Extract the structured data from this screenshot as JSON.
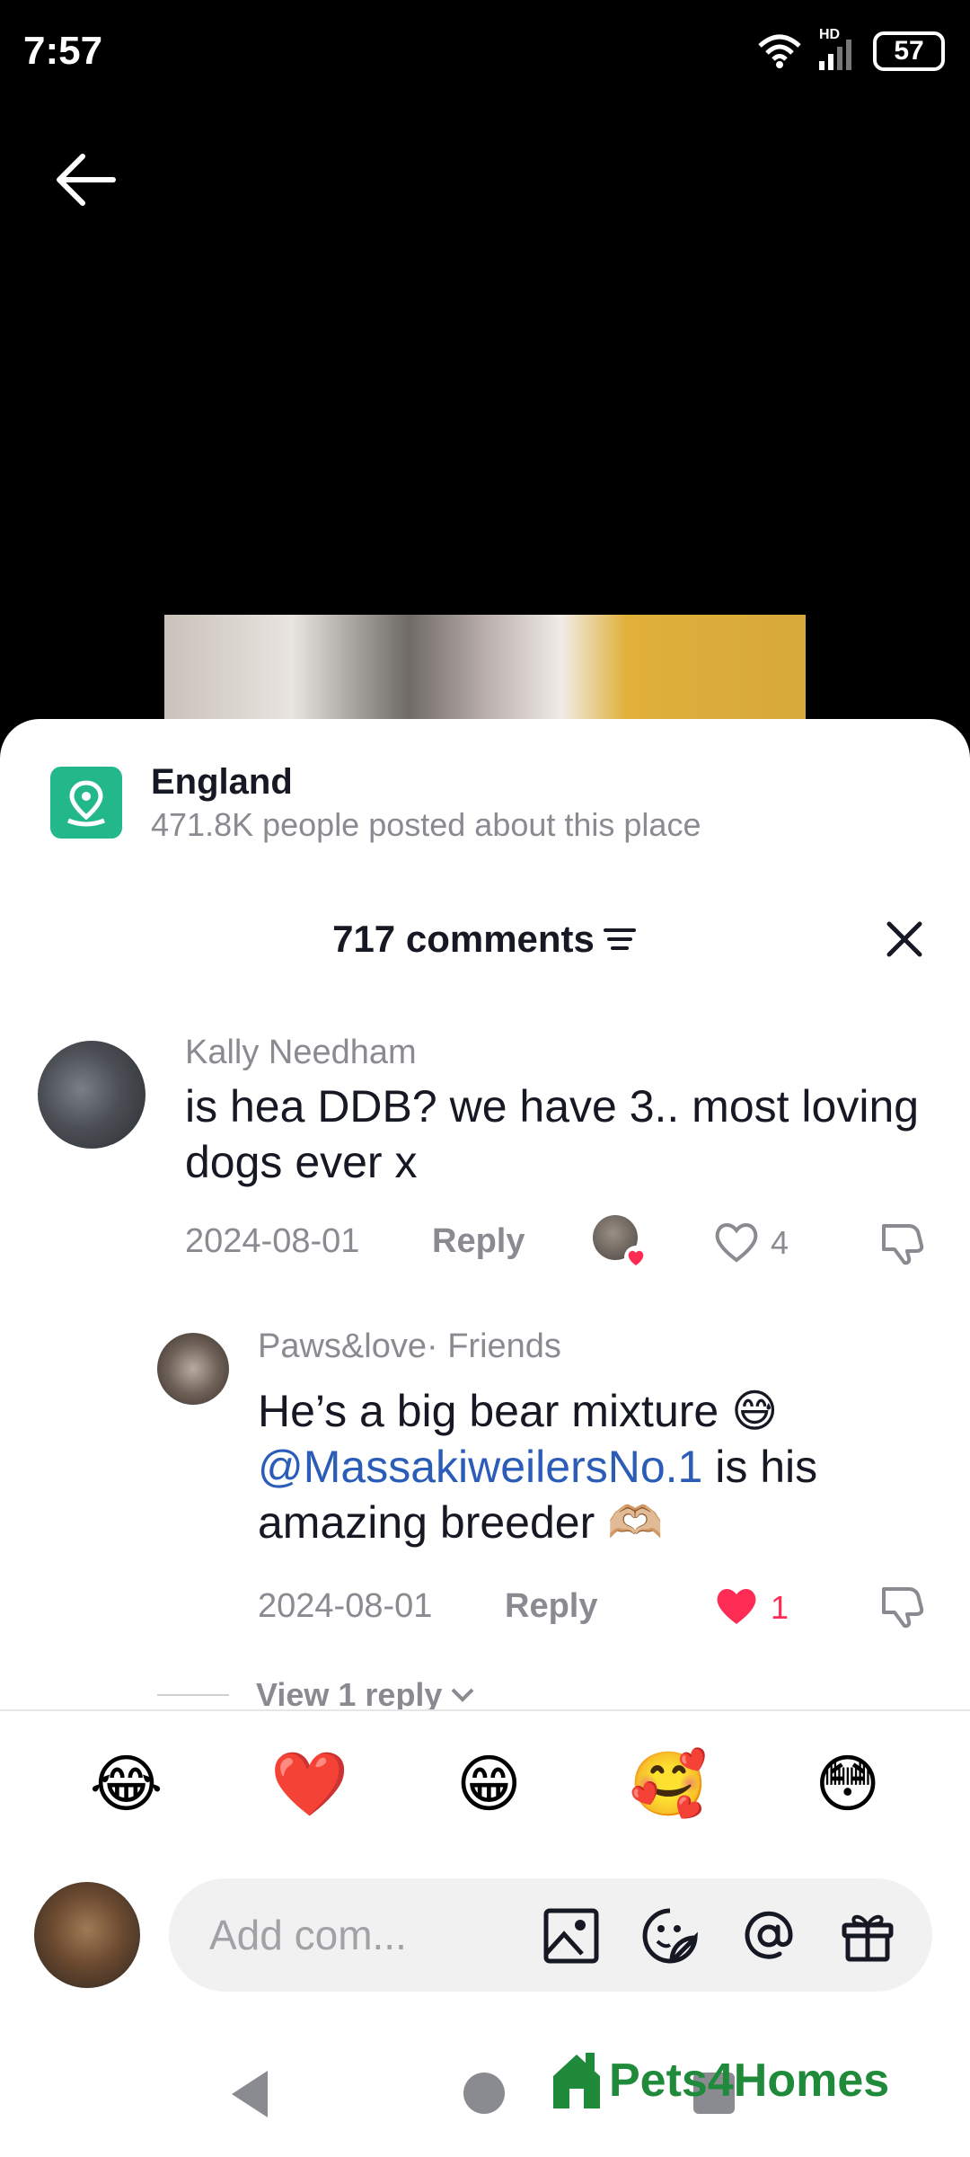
{
  "status_bar": {
    "time": "7:57",
    "network": "HD",
    "battery": "57"
  },
  "location": {
    "title": "England",
    "subtitle": "471.8K people posted about this place"
  },
  "comments_header": {
    "title": "717 comments"
  },
  "comments": [
    {
      "username": "Kally Needham",
      "text": "is hea DDB? we have 3.. most loving dogs ever x",
      "date": "2024-08-01",
      "reply_label": "Reply",
      "likes": "4"
    },
    {
      "username": "Paws&love",
      "relation": "· Friends",
      "text_before": "He’s a big bear mixture 😅",
      "mention": "@MassakiweilersNo.1",
      "text_after": " is his amazing breeder 🫶🏼",
      "date": "2024-08-01",
      "reply_label": "Reply",
      "likes": "1"
    }
  ],
  "view_replies": "View 1 reply",
  "emoji_bar": [
    "😂",
    "❤️",
    "😁",
    "🥰",
    "😳"
  ],
  "input": {
    "placeholder": "Add com..."
  },
  "watermark": "Pets4Homes",
  "colors": {
    "accent_like": "#fe2c55",
    "location_icon": "#22b88a",
    "mention": "#2b5db8",
    "watermark": "#1f8a3a"
  }
}
